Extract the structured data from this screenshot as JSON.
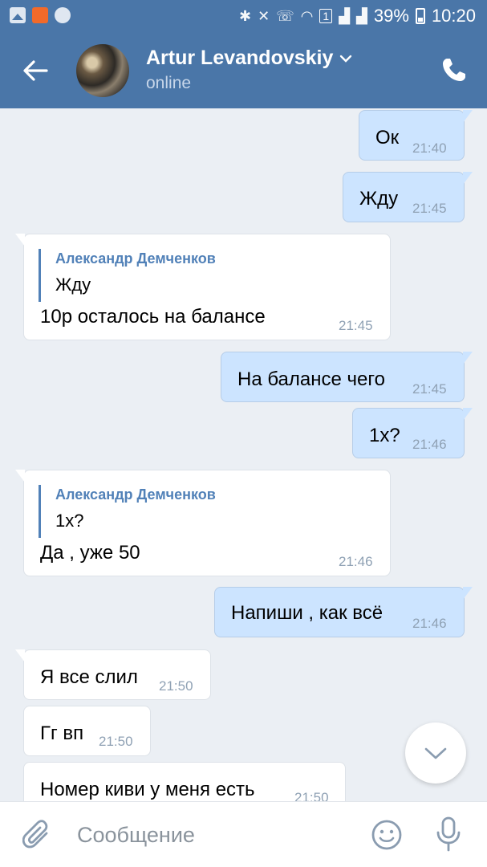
{
  "status_bar": {
    "battery": "39%",
    "time": "10:20",
    "sim_badge": "1"
  },
  "header": {
    "name": "Artur Levandovskiy",
    "status": "online"
  },
  "messages": [
    {
      "dir": "out",
      "text": "Ок",
      "time": "21:40"
    },
    {
      "dir": "out",
      "text": "Жду",
      "time": "21:45"
    },
    {
      "dir": "in",
      "reply_author": "Александр Демченков",
      "reply_text": "Жду",
      "text": "10р осталось на балансе",
      "time": "21:45"
    },
    {
      "dir": "out",
      "text": "На балансе чего",
      "time": "21:45"
    },
    {
      "dir": "out",
      "text": "1х?",
      "time": "21:46"
    },
    {
      "dir": "in",
      "reply_author": "Александр Демченков",
      "reply_text": "1х?",
      "text": "Да , уже 50",
      "time": "21:46"
    },
    {
      "dir": "out",
      "text": "Напиши , как всё",
      "time": "21:46"
    },
    {
      "dir": "in",
      "text": "Я все слил",
      "time": "21:50"
    },
    {
      "dir": "in",
      "text": "Гг вп",
      "time": "21:50"
    },
    {
      "dir": "in",
      "text": "Номер киви у меня есть",
      "time": "21:50"
    }
  ],
  "composer": {
    "placeholder": "Сообщение"
  },
  "colors": {
    "brand": "#4a76a8",
    "outgoing_bubble": "#cce4ff",
    "incoming_bubble": "#ffffff",
    "chat_background": "#ebeff4"
  },
  "icons": [
    "back-arrow-icon",
    "chevron-down-icon",
    "phone-icon",
    "chevron-down-scroll-icon",
    "paperclip-icon",
    "emoji-icon",
    "microphone-icon"
  ]
}
